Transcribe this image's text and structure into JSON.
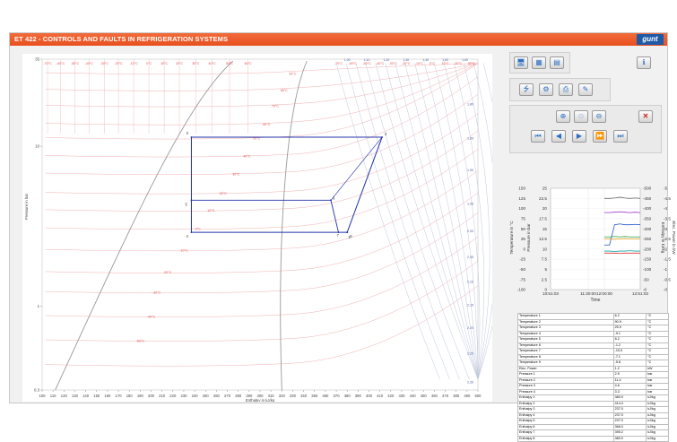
{
  "app": {
    "title": "ET 422 - CONTROLS AND FAULTS IN REFRIGERATION SYSTEMS",
    "logo_text": "gunt",
    "accent": "#e8501f"
  },
  "toolbar": {
    "row1": [
      {
        "name": "monitor-view-icon",
        "glyph": "🖥"
      },
      {
        "name": "diagram-view-icon",
        "glyph": "▦"
      },
      {
        "name": "table-view-icon",
        "glyph": "▤"
      }
    ],
    "info": {
      "name": "info-icon",
      "glyph": "ℹ"
    },
    "row2": [
      {
        "name": "usb-icon",
        "glyph": "⭍"
      },
      {
        "name": "settings-icon",
        "glyph": "⚙"
      },
      {
        "name": "print-icon",
        "glyph": "⎙"
      },
      {
        "name": "lightbulb-icon",
        "glyph": "✎"
      }
    ],
    "row3": [
      {
        "name": "zoom-in-icon",
        "glyph": "⊕"
      },
      {
        "name": "zoom-reset-icon",
        "glyph": "⊙"
      },
      {
        "name": "zoom-out-icon",
        "glyph": "⊖"
      }
    ],
    "close": {
      "name": "close-icon",
      "glyph": "✕"
    },
    "row4": [
      {
        "name": "step-first-icon",
        "glyph": "⏮"
      },
      {
        "name": "step-back-icon",
        "glyph": "◀"
      },
      {
        "name": "step-forward-icon",
        "glyph": "▶"
      },
      {
        "name": "fast-forward-icon",
        "glyph": "⏩"
      },
      {
        "name": "step-last-icon",
        "glyph": "⏭"
      }
    ]
  },
  "chart_data": [
    {
      "type": "line",
      "title": "",
      "xlabel": "Enthalpy in kJ/kg",
      "ylabel": "Pressure in bar",
      "xlim": [
        100,
        500
      ],
      "ylim": [
        0.3,
        35
      ],
      "yscale": "log",
      "x_ticks": [
        100,
        110,
        120,
        130,
        140,
        150,
        160,
        170,
        180,
        190,
        200,
        210,
        220,
        230,
        240,
        250,
        260,
        270,
        280,
        290,
        300,
        310,
        320,
        330,
        340,
        350,
        360,
        370,
        380,
        390,
        400,
        410,
        420,
        430,
        440,
        450,
        460,
        470,
        480,
        490,
        500
      ],
      "y_ticks": [
        {
          "v": 35,
          "l": "35"
        },
        {
          "v": 10,
          "l": "10"
        },
        {
          "v": 1,
          "l": "1"
        },
        {
          "v": 0.3,
          "l": "0.3"
        }
      ],
      "top_temp_labels": [
        {
          "h": 105,
          "l": "-70°C"
        },
        {
          "h": 117,
          "l": "-60°C"
        },
        {
          "h": 130,
          "l": "-50°C"
        },
        {
          "h": 143,
          "l": "-40°C"
        },
        {
          "h": 157,
          "l": "-30°C"
        },
        {
          "h": 170,
          "l": "-20°C"
        },
        {
          "h": 184,
          "l": "-10°C"
        },
        {
          "h": 198,
          "l": "0°C"
        },
        {
          "h": 212,
          "l": "10°C"
        },
        {
          "h": 226,
          "l": "20°C"
        },
        {
          "h": 241,
          "l": "30°C"
        },
        {
          "h": 256,
          "l": "40°C"
        },
        {
          "h": 272,
          "l": "50°C"
        },
        {
          "h": 289,
          "l": "60°C"
        },
        {
          "h": 372,
          "l": "-70°C"
        },
        {
          "h": 385,
          "l": "-60°C"
        },
        {
          "h": 398,
          "l": "-50°C"
        },
        {
          "h": 410,
          "l": "-40°C"
        },
        {
          "h": 422,
          "l": "-30°C"
        },
        {
          "h": 434,
          "l": "-20°C"
        },
        {
          "h": 446,
          "l": "-10°C"
        },
        {
          "h": 458,
          "l": "0°C"
        },
        {
          "h": 470,
          "l": "10°C"
        },
        {
          "h": 482,
          "l": "20°C"
        },
        {
          "h": 494,
          "l": "30°C"
        }
      ],
      "top_entropy_labels": [
        {
          "h": 380,
          "l": "1,00"
        },
        {
          "h": 398,
          "l": "1,10"
        },
        {
          "h": 416,
          "l": "1,20"
        },
        {
          "h": 434,
          "l": "1,30"
        },
        {
          "h": 452,
          "l": "1,40"
        },
        {
          "h": 470,
          "l": "1,50"
        },
        {
          "h": 488,
          "l": "1,60"
        }
      ],
      "right_entropy_labels": [
        {
          "p": 18,
          "l": "1,80"
        },
        {
          "p": 11,
          "l": "1,85"
        },
        {
          "p": 7,
          "l": "1,90"
        },
        {
          "p": 4.3,
          "l": "1,95"
        },
        {
          "p": 2.9,
          "l": "2,00"
        },
        {
          "p": 2.0,
          "l": "2,05"
        },
        {
          "p": 1.4,
          "l": "2,10"
        },
        {
          "p": 1.0,
          "l": "2,15"
        },
        {
          "p": 0.72,
          "l": "2,20"
        },
        {
          "p": 0.5,
          "l": "2,25"
        },
        {
          "p": 0.33,
          "l": "2,30"
        }
      ],
      "isotherm_labels": [
        {
          "h": 330,
          "p": 28,
          "l": "90°C"
        },
        {
          "h": 322,
          "p": 22,
          "l": "80°C"
        },
        {
          "h": 314,
          "p": 17.5,
          "l": "70°C"
        },
        {
          "h": 306,
          "p": 13.5,
          "l": "60°C"
        },
        {
          "h": 297,
          "p": 11,
          "l": "50°C"
        },
        {
          "h": 288,
          "p": 8.5,
          "l": "40°C"
        },
        {
          "h": 278,
          "p": 6.6,
          "l": "30°C"
        },
        {
          "h": 266,
          "p": 5,
          "l": "20°C"
        },
        {
          "h": 255,
          "p": 3.9,
          "l": "10°C"
        },
        {
          "h": 243,
          "p": 3,
          "l": "0°C"
        },
        {
          "h": 230,
          "p": 2.2,
          "l": "-10°C"
        },
        {
          "h": 215,
          "p": 1.6,
          "l": "-20°C"
        },
        {
          "h": 205,
          "p": 1.2,
          "l": "-30°C"
        },
        {
          "h": 200,
          "p": 0.85,
          "l": "-40°C"
        },
        {
          "h": 190,
          "p": 0.6,
          "l": "-50°C"
        }
      ],
      "cycle_points": [
        {
          "id": "2",
          "h": 412,
          "p": 11.4
        },
        {
          "id": "3",
          "h": 237,
          "p": 11.4
        },
        {
          "id": "4",
          "h": 237,
          "p": 2.9
        },
        {
          "id": "1",
          "h": 380,
          "p": 2.9
        },
        {
          "id": "5",
          "h": 237,
          "p": 4.6
        },
        {
          "id": "6",
          "h": 365,
          "p": 4.6
        },
        {
          "id": "7",
          "h": 372,
          "p": 2.9
        },
        {
          "id": "8",
          "h": 380,
          "p": 2.9
        }
      ]
    },
    {
      "type": "line",
      "title": "",
      "xlabel": "Time",
      "ylabel_left": "Temperature in °C",
      "ylabel_left2": "Pressure in bar",
      "ylabel_right": "Enthalpy in kJ/kg",
      "ylabel_right2": "Elec. Power in kW",
      "x_ticks": [
        "10:51:03",
        "11:30:00",
        "12:00:00",
        "12:51:03"
      ],
      "y_left_temp": [
        "150",
        "125",
        "100",
        "75",
        "50",
        "25",
        "0",
        "-25",
        "-50",
        "-75",
        "-100"
      ],
      "y_left_press": [
        "25",
        "22.5",
        "20",
        "17.5",
        "15",
        "12.5",
        "10",
        "7.5",
        "5",
        "2.5",
        "0"
      ],
      "y_right_enth": [
        "500",
        "450",
        "400",
        "350",
        "300",
        "250",
        "200",
        "150",
        "100",
        "50",
        "0"
      ],
      "y_right_power": [
        "5",
        "4.5",
        "4",
        "3.5",
        "3",
        "2.5",
        "2",
        "1.5",
        "1",
        "0.5",
        "0"
      ],
      "series": [
        {
          "color": "#e03030",
          "values": [
            -10,
            -10,
            -10,
            -11,
            -10,
            -10,
            -10,
            -10
          ]
        },
        {
          "color": "#2255cc",
          "values": [
            10,
            10,
            60,
            62,
            60,
            60,
            61,
            60
          ]
        },
        {
          "color": "#20a040",
          "values": [
            30,
            30,
            31,
            30,
            31,
            30,
            30,
            30
          ]
        },
        {
          "color": "#9933cc",
          "values": [
            90,
            90,
            91,
            92,
            91,
            90,
            91,
            90
          ]
        },
        {
          "color": "#e0a020",
          "values": [
            25,
            25,
            24,
            25,
            26,
            25,
            25,
            25
          ]
        },
        {
          "color": "#10a0a0",
          "values": [
            -5,
            -5,
            -6,
            -5,
            -5,
            -4,
            -5,
            -5
          ]
        },
        {
          "color": "#666666",
          "values": [
            125,
            125,
            126,
            128,
            126,
            125,
            126,
            125
          ]
        }
      ]
    }
  ],
  "table": [
    {
      "name": "Temperature 1",
      "value": "6.2",
      "unit": "°C"
    },
    {
      "name": "Temperature 2",
      "value": "90.9",
      "unit": "°C"
    },
    {
      "name": "Temperature 3",
      "value": "25.9",
      "unit": "°C"
    },
    {
      "name": "Temperature 4",
      "value": "-9.1",
      "unit": "°C"
    },
    {
      "name": "Temperature 5",
      "value": "8.2",
      "unit": "°C"
    },
    {
      "name": "Temperature 6",
      "value": "-1.2",
      "unit": "°C"
    },
    {
      "name": "Temperature 7",
      "value": "-10.0",
      "unit": "°C"
    },
    {
      "name": "Temperature 8",
      "value": "-7.1",
      "unit": "°C"
    },
    {
      "name": "Temperature 9",
      "value": "-5.8",
      "unit": "°C"
    },
    {
      "name": "Elec. Power",
      "value": "1.2",
      "unit": "kW"
    },
    {
      "name": "Pressure 1",
      "value": "2.9",
      "unit": "bar"
    },
    {
      "name": "Pressure 2",
      "value": "11.4",
      "unit": "bar"
    },
    {
      "name": "Pressure 3",
      "value": "4.6",
      "unit": "bar"
    },
    {
      "name": "Pressure 4",
      "value": "3.3",
      "unit": "bar"
    },
    {
      "name": "Enthalpy 1",
      "value": "380.9",
      "unit": "kJ/kg"
    },
    {
      "name": "Enthalpy 2",
      "value": "414.4",
      "unit": "kJ/kg"
    },
    {
      "name": "Enthalpy 3",
      "value": "237.0",
      "unit": "kJ/kg"
    },
    {
      "name": "Enthalpy 4",
      "value": "237.0",
      "unit": "kJ/kg"
    },
    {
      "name": "Enthalpy 5",
      "value": "237.0",
      "unit": "kJ/kg"
    },
    {
      "name": "Enthalpy 6",
      "value": "366.0",
      "unit": "kJ/kg"
    },
    {
      "name": "Enthalpy 7",
      "value": "395.2",
      "unit": "kJ/kg"
    },
    {
      "name": "Enthalpy 8",
      "value": "380.0",
      "unit": "kJ/kg"
    }
  ]
}
